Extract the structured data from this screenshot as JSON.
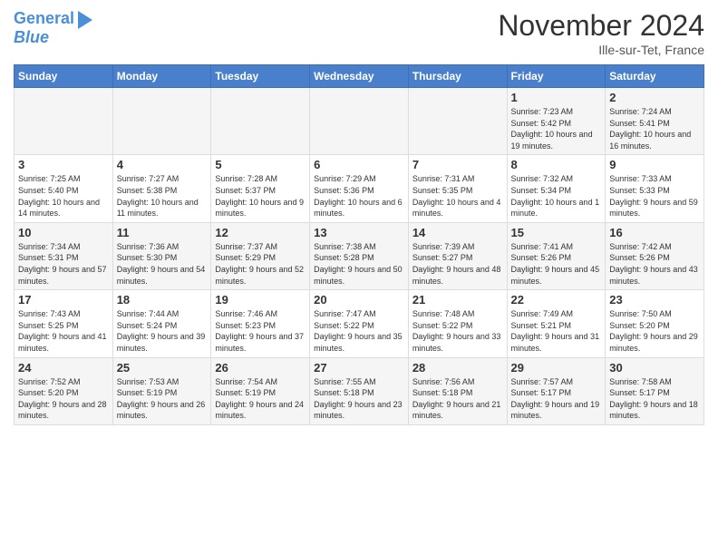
{
  "header": {
    "logo_line1": "General",
    "logo_line2": "Blue",
    "month_title": "November 2024",
    "location": "Ille-sur-Tet, France"
  },
  "days_of_week": [
    "Sunday",
    "Monday",
    "Tuesday",
    "Wednesday",
    "Thursday",
    "Friday",
    "Saturday"
  ],
  "weeks": [
    [
      {
        "num": "",
        "detail": ""
      },
      {
        "num": "",
        "detail": ""
      },
      {
        "num": "",
        "detail": ""
      },
      {
        "num": "",
        "detail": ""
      },
      {
        "num": "",
        "detail": ""
      },
      {
        "num": "1",
        "detail": "Sunrise: 7:23 AM\nSunset: 5:42 PM\nDaylight: 10 hours and 19 minutes."
      },
      {
        "num": "2",
        "detail": "Sunrise: 7:24 AM\nSunset: 5:41 PM\nDaylight: 10 hours and 16 minutes."
      }
    ],
    [
      {
        "num": "3",
        "detail": "Sunrise: 7:25 AM\nSunset: 5:40 PM\nDaylight: 10 hours and 14 minutes."
      },
      {
        "num": "4",
        "detail": "Sunrise: 7:27 AM\nSunset: 5:38 PM\nDaylight: 10 hours and 11 minutes."
      },
      {
        "num": "5",
        "detail": "Sunrise: 7:28 AM\nSunset: 5:37 PM\nDaylight: 10 hours and 9 minutes."
      },
      {
        "num": "6",
        "detail": "Sunrise: 7:29 AM\nSunset: 5:36 PM\nDaylight: 10 hours and 6 minutes."
      },
      {
        "num": "7",
        "detail": "Sunrise: 7:31 AM\nSunset: 5:35 PM\nDaylight: 10 hours and 4 minutes."
      },
      {
        "num": "8",
        "detail": "Sunrise: 7:32 AM\nSunset: 5:34 PM\nDaylight: 10 hours and 1 minute."
      },
      {
        "num": "9",
        "detail": "Sunrise: 7:33 AM\nSunset: 5:33 PM\nDaylight: 9 hours and 59 minutes."
      }
    ],
    [
      {
        "num": "10",
        "detail": "Sunrise: 7:34 AM\nSunset: 5:31 PM\nDaylight: 9 hours and 57 minutes."
      },
      {
        "num": "11",
        "detail": "Sunrise: 7:36 AM\nSunset: 5:30 PM\nDaylight: 9 hours and 54 minutes."
      },
      {
        "num": "12",
        "detail": "Sunrise: 7:37 AM\nSunset: 5:29 PM\nDaylight: 9 hours and 52 minutes."
      },
      {
        "num": "13",
        "detail": "Sunrise: 7:38 AM\nSunset: 5:28 PM\nDaylight: 9 hours and 50 minutes."
      },
      {
        "num": "14",
        "detail": "Sunrise: 7:39 AM\nSunset: 5:27 PM\nDaylight: 9 hours and 48 minutes."
      },
      {
        "num": "15",
        "detail": "Sunrise: 7:41 AM\nSunset: 5:26 PM\nDaylight: 9 hours and 45 minutes."
      },
      {
        "num": "16",
        "detail": "Sunrise: 7:42 AM\nSunset: 5:26 PM\nDaylight: 9 hours and 43 minutes."
      }
    ],
    [
      {
        "num": "17",
        "detail": "Sunrise: 7:43 AM\nSunset: 5:25 PM\nDaylight: 9 hours and 41 minutes."
      },
      {
        "num": "18",
        "detail": "Sunrise: 7:44 AM\nSunset: 5:24 PM\nDaylight: 9 hours and 39 minutes."
      },
      {
        "num": "19",
        "detail": "Sunrise: 7:46 AM\nSunset: 5:23 PM\nDaylight: 9 hours and 37 minutes."
      },
      {
        "num": "20",
        "detail": "Sunrise: 7:47 AM\nSunset: 5:22 PM\nDaylight: 9 hours and 35 minutes."
      },
      {
        "num": "21",
        "detail": "Sunrise: 7:48 AM\nSunset: 5:22 PM\nDaylight: 9 hours and 33 minutes."
      },
      {
        "num": "22",
        "detail": "Sunrise: 7:49 AM\nSunset: 5:21 PM\nDaylight: 9 hours and 31 minutes."
      },
      {
        "num": "23",
        "detail": "Sunrise: 7:50 AM\nSunset: 5:20 PM\nDaylight: 9 hours and 29 minutes."
      }
    ],
    [
      {
        "num": "24",
        "detail": "Sunrise: 7:52 AM\nSunset: 5:20 PM\nDaylight: 9 hours and 28 minutes."
      },
      {
        "num": "25",
        "detail": "Sunrise: 7:53 AM\nSunset: 5:19 PM\nDaylight: 9 hours and 26 minutes."
      },
      {
        "num": "26",
        "detail": "Sunrise: 7:54 AM\nSunset: 5:19 PM\nDaylight: 9 hours and 24 minutes."
      },
      {
        "num": "27",
        "detail": "Sunrise: 7:55 AM\nSunset: 5:18 PM\nDaylight: 9 hours and 23 minutes."
      },
      {
        "num": "28",
        "detail": "Sunrise: 7:56 AM\nSunset: 5:18 PM\nDaylight: 9 hours and 21 minutes."
      },
      {
        "num": "29",
        "detail": "Sunrise: 7:57 AM\nSunset: 5:17 PM\nDaylight: 9 hours and 19 minutes."
      },
      {
        "num": "30",
        "detail": "Sunrise: 7:58 AM\nSunset: 5:17 PM\nDaylight: 9 hours and 18 minutes."
      }
    ]
  ]
}
